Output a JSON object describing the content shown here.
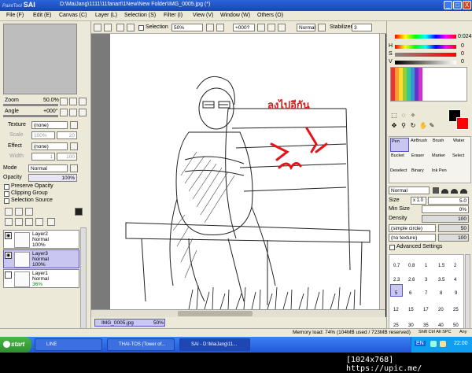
{
  "window": {
    "logo_small": "PaintTool",
    "logo_big": "SAI",
    "path": "D:\\MaiJang\\1111\\11fanart\\1New\\New Folder\\IMG_0005.jpg (*)",
    "min": "_",
    "max": "□",
    "close": "X"
  },
  "menu": {
    "file": "File (F)",
    "edit": "Edit (E)",
    "canvas": "Canvas (C)",
    "layer": "Layer (L)",
    "selection": "Selection (S)",
    "filter": "Filter (I)",
    "view": "View (V)",
    "window": "Window (W)",
    "others": "Others (O)"
  },
  "navigator": {
    "zoom_label": "Zoom",
    "zoom_value": "50.0%",
    "angle_label": "Angle",
    "angle_value": "+000°"
  },
  "layer_props": {
    "texture_label": "Texture",
    "texture_value": "(none)",
    "scale_label": "Scale",
    "scale_value": "100%",
    "scale_num": "20",
    "effect_label": "Effect",
    "effect_value": "(none)",
    "width_label": "Width",
    "width_value": "1",
    "width_num": "100",
    "mode_label": "Mode",
    "mode_value": "Normal",
    "opacity_label": "Opacity",
    "opacity_value": "100%",
    "preserve_opacity": "Preserve Opacity",
    "clipping_group": "Clipping Group",
    "selection_source": "Selection Source"
  },
  "layers": [
    {
      "name": "Layer2",
      "mode": "Normal",
      "opacity": "100%",
      "selected": false
    },
    {
      "name": "Layer3",
      "mode": "Normal",
      "opacity": "100%",
      "selected": true
    },
    {
      "name": "Layer1",
      "mode": "Normal",
      "opacity": "36%",
      "selected": false
    }
  ],
  "toolbar": {
    "selection_label": "Selection",
    "zoom_value": "50%",
    "angle_value": "+000?",
    "blend_value": "Normal",
    "stabilizer_label": "Stabilizer",
    "stabilizer_value": "3"
  },
  "canvas": {
    "thai_text": "ลงไปอีกัน"
  },
  "doc_tab": {
    "name": "IMG_0005.jpg",
    "zoom": "50%"
  },
  "color": {
    "h_label": "H",
    "h_value": "0",
    "s_label": "S",
    "s_value": "0",
    "v_label": "V",
    "v_value": "0",
    "top_value": "0:024",
    "fg": "#000000",
    "bg": "#ff0000"
  },
  "tools": {
    "pen": "Pen",
    "airbrush": "AirBrush",
    "brush": "Brush",
    "water": "Water",
    "bucket": "Bucket",
    "eraser": "Eraser",
    "marker": "Marker",
    "select": "Select",
    "deselect": "Deselect",
    "binary": "Binary",
    "ink_pen": "Ink Pen"
  },
  "brush": {
    "mode_value": "Normal",
    "size_label": "Size",
    "size_mult": "x 1.0",
    "size_value": "5.0",
    "min_size_label": "Min Size",
    "min_size_value": "0%",
    "density_label": "Density",
    "density_value": "100",
    "shape_value": "(simple circle)",
    "shape_num": "50",
    "texture_value": "(no texture)",
    "texture_num": "100",
    "advanced": "Advanced Settings",
    "sizes_row1": [
      "0.7",
      "0.8",
      "1",
      "1.5",
      "2"
    ],
    "sizes_row2": [
      "2.3",
      "2.6",
      "3",
      "3.5",
      "4"
    ],
    "sizes_row3": [
      "5",
      "6",
      "7",
      "8",
      "9"
    ],
    "sizes_row4": [
      "12",
      "15",
      "17",
      "20",
      "25"
    ],
    "sizes_row5": [
      "25",
      "30",
      "35",
      "40",
      "50"
    ]
  },
  "status": {
    "memory": "Memory load: 74% (104MB used / 723MB reserved)",
    "keys": "Shift Ctrl Alt SPC",
    "any": "Any"
  },
  "taskbar": {
    "start": "start",
    "line": "LINE",
    "chrome": "THAI-TOS (Tower of...",
    "sai": "SAI - D:\\MaiJang\\11...",
    "lang": "EN",
    "time": "22:00"
  },
  "footer": {
    "text": "[1024x768] https://upic.me/"
  }
}
